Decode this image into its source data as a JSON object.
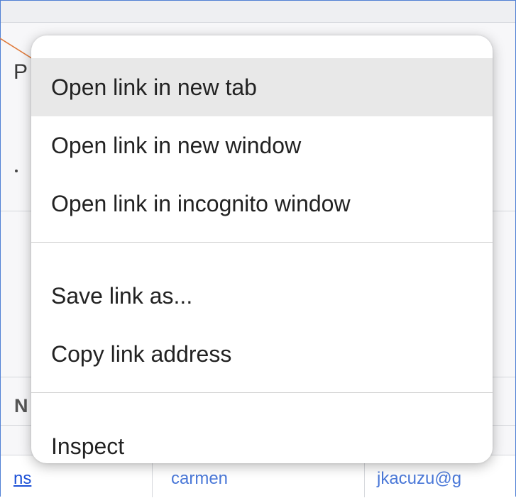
{
  "background": {
    "partial_letter_top": "P",
    "partial_letter_bottom": "N",
    "row": {
      "link_fragment": "ns",
      "middle_fragment": "carmen",
      "right_fragment": "jkacuzu@g"
    }
  },
  "context_menu": {
    "group1": [
      {
        "label": "Open link in new tab",
        "highlighted": true
      },
      {
        "label": "Open link in new window",
        "highlighted": false
      },
      {
        "label": "Open link in incognito window",
        "highlighted": false
      }
    ],
    "group2": [
      {
        "label": "Save link as..."
      },
      {
        "label": "Copy link address"
      }
    ],
    "group3": [
      {
        "label": "Inspect"
      }
    ]
  },
  "colors": {
    "menu_background": "#ffffff",
    "highlight": "#e8e8e8",
    "separator": "#d0d0d0",
    "annotation_arrow": "#e07a3a",
    "frame_border": "#4f7fd4",
    "link": "#1a4fd6"
  }
}
